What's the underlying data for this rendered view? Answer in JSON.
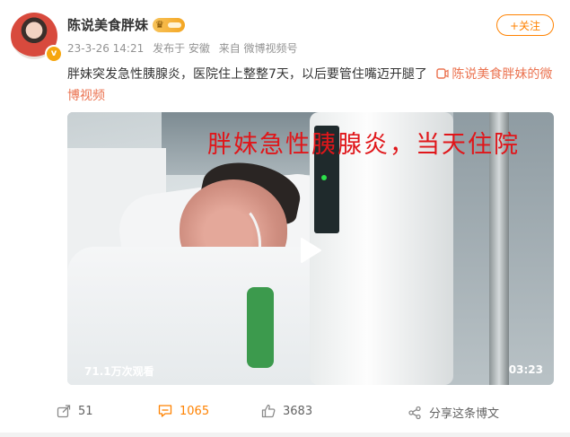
{
  "post": {
    "username": "陈说美食胖妹",
    "timestamp": "23-3-26 14:21",
    "source_prefix": "发布于 安徽",
    "source": "来自 微博视频号",
    "follow_label": "+关注",
    "text": "胖妹突发急性胰腺炎，医院住上整整7天，以后要管住嘴迈开腿了",
    "video_link_text": "陈说美食胖妹的微博视频",
    "icons": {
      "verified": "verified-badge-icon",
      "vip": "vip-crown-icon",
      "video_link": "video-link-icon"
    }
  },
  "video": {
    "caption": "胖妹急性胰腺炎，当天住院",
    "views": "71.1万次观看",
    "duration": "03:23",
    "play_icon": "play-icon"
  },
  "actions": {
    "share": {
      "icon": "share-icon",
      "count": "51"
    },
    "comment": {
      "icon": "comment-icon",
      "count": "1065"
    },
    "like": {
      "icon": "thumbs-up-icon",
      "count": "3683"
    },
    "weibo_share": {
      "icon": "share-nodes-icon",
      "label": "分享这条博文"
    }
  },
  "colors": {
    "accent": "#ff8200",
    "link": "#eb7350",
    "caption": "#e0161a"
  }
}
